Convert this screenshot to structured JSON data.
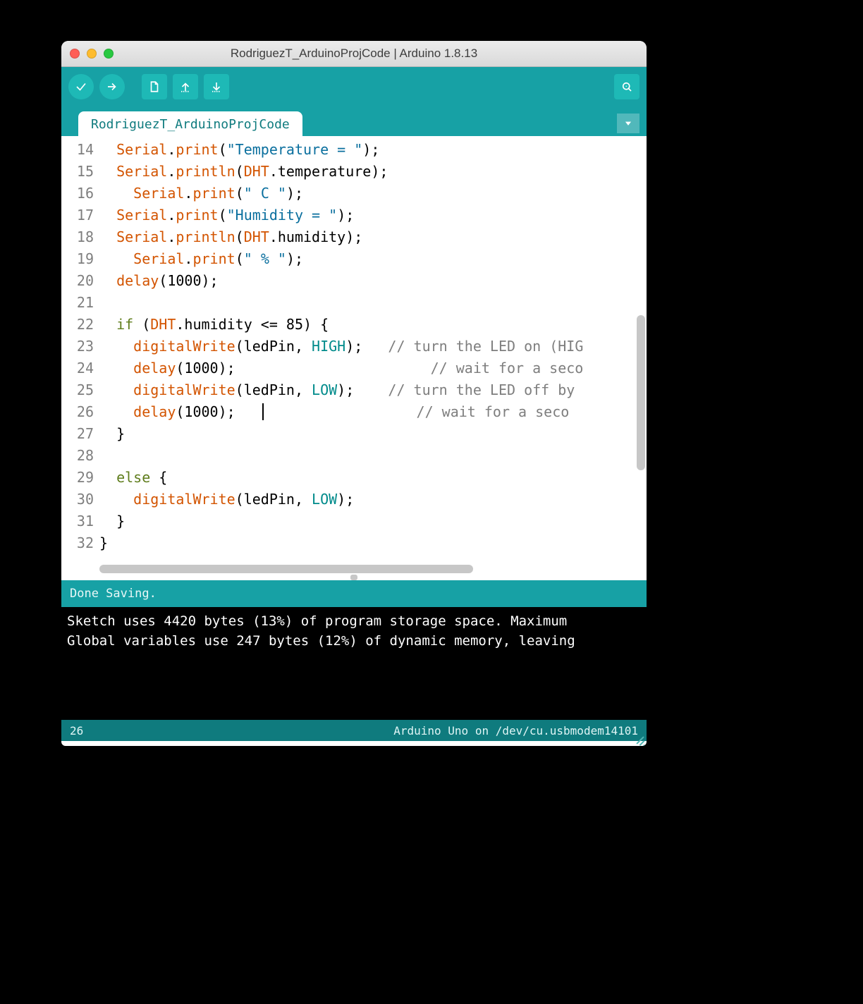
{
  "window": {
    "title": "RodriguezT_ArduinoProjCode | Arduino 1.8.13"
  },
  "tab": {
    "label": "RodriguezT_ArduinoProjCode"
  },
  "toolbar": {
    "verify_tip": "Verify",
    "upload_tip": "Upload",
    "new_tip": "New",
    "open_tip": "Open",
    "save_tip": "Save",
    "serial_tip": "Serial Monitor"
  },
  "gutter": {
    "start": 14,
    "end": 32
  },
  "code": {
    "lines": [
      [
        {
          "c": "k-orange",
          "t": "  Serial"
        },
        {
          "c": "k-black",
          "t": "."
        },
        {
          "c": "k-orange",
          "t": "print"
        },
        {
          "c": "k-black",
          "t": "("
        },
        {
          "c": "k-str",
          "t": "\"Temperature = \""
        },
        {
          "c": "k-black",
          "t": ");"
        }
      ],
      [
        {
          "c": "k-orange",
          "t": "  Serial"
        },
        {
          "c": "k-black",
          "t": "."
        },
        {
          "c": "k-orange",
          "t": "println"
        },
        {
          "c": "k-black",
          "t": "("
        },
        {
          "c": "k-orange",
          "t": "DHT"
        },
        {
          "c": "k-black",
          "t": ".temperature);"
        }
      ],
      [
        {
          "c": "k-orange",
          "t": "    Serial"
        },
        {
          "c": "k-black",
          "t": "."
        },
        {
          "c": "k-orange",
          "t": "print"
        },
        {
          "c": "k-black",
          "t": "("
        },
        {
          "c": "k-str",
          "t": "\" C \""
        },
        {
          "c": "k-black",
          "t": ");"
        }
      ],
      [
        {
          "c": "k-orange",
          "t": "  Serial"
        },
        {
          "c": "k-black",
          "t": "."
        },
        {
          "c": "k-orange",
          "t": "print"
        },
        {
          "c": "k-black",
          "t": "("
        },
        {
          "c": "k-str",
          "t": "\"Humidity = \""
        },
        {
          "c": "k-black",
          "t": ");"
        }
      ],
      [
        {
          "c": "k-orange",
          "t": "  Serial"
        },
        {
          "c": "k-black",
          "t": "."
        },
        {
          "c": "k-orange",
          "t": "println"
        },
        {
          "c": "k-black",
          "t": "("
        },
        {
          "c": "k-orange",
          "t": "DHT"
        },
        {
          "c": "k-black",
          "t": ".humidity);"
        }
      ],
      [
        {
          "c": "k-orange",
          "t": "    Serial"
        },
        {
          "c": "k-black",
          "t": "."
        },
        {
          "c": "k-orange",
          "t": "print"
        },
        {
          "c": "k-black",
          "t": "("
        },
        {
          "c": "k-str",
          "t": "\" % \""
        },
        {
          "c": "k-black",
          "t": ");"
        }
      ],
      [
        {
          "c": "k-orange",
          "t": "  delay"
        },
        {
          "c": "k-black",
          "t": "(1000);"
        }
      ],
      [
        {
          "c": "k-black",
          "t": " "
        }
      ],
      [
        {
          "c": "k-green",
          "t": "  if"
        },
        {
          "c": "k-black",
          "t": " ("
        },
        {
          "c": "k-orange",
          "t": "DHT"
        },
        {
          "c": "k-black",
          "t": ".humidity <= 85) {"
        }
      ],
      [
        {
          "c": "k-orange",
          "t": "    digitalWrite"
        },
        {
          "c": "k-black",
          "t": "(ledPin, "
        },
        {
          "c": "k-teal",
          "t": "HIGH"
        },
        {
          "c": "k-black",
          "t": ");   "
        },
        {
          "c": "k-com",
          "t": "// turn the LED on (HIG"
        }
      ],
      [
        {
          "c": "k-orange",
          "t": "    delay"
        },
        {
          "c": "k-black",
          "t": "(1000);                       "
        },
        {
          "c": "k-com",
          "t": "// wait for a seco"
        }
      ],
      [
        {
          "c": "k-orange",
          "t": "    digitalWrite"
        },
        {
          "c": "k-black",
          "t": "(ledPin, "
        },
        {
          "c": "k-teal",
          "t": "LOW"
        },
        {
          "c": "k-black",
          "t": ");    "
        },
        {
          "c": "k-com",
          "t": "// turn the LED off by "
        }
      ],
      [
        {
          "c": "k-orange",
          "t": "    delay"
        },
        {
          "c": "k-black",
          "t": "(1000);   "
        },
        {
          "c": "cursor",
          "t": ""
        },
        {
          "c": "k-black",
          "t": "                  "
        },
        {
          "c": "k-com",
          "t": "// wait for a seco"
        }
      ],
      [
        {
          "c": "k-black",
          "t": "  }"
        }
      ],
      [
        {
          "c": "k-black",
          "t": " "
        }
      ],
      [
        {
          "c": "k-green",
          "t": "  else"
        },
        {
          "c": "k-black",
          "t": " {"
        }
      ],
      [
        {
          "c": "k-orange",
          "t": "    digitalWrite"
        },
        {
          "c": "k-black",
          "t": "(ledPin, "
        },
        {
          "c": "k-teal",
          "t": "LOW"
        },
        {
          "c": "k-black",
          "t": ");"
        }
      ],
      [
        {
          "c": "k-black",
          "t": "  }"
        }
      ],
      [
        {
          "c": "k-black",
          "t": "}"
        }
      ]
    ]
  },
  "status": {
    "message": "Done Saving."
  },
  "console": {
    "lines": [
      "Sketch uses 4420 bytes (13%) of program storage space. Maximum ",
      "Global variables use 247 bytes (12%) of dynamic memory, leaving"
    ]
  },
  "bottombar": {
    "line_no": "26",
    "board_info": "Arduino Uno on /dev/cu.usbmodem14101"
  }
}
